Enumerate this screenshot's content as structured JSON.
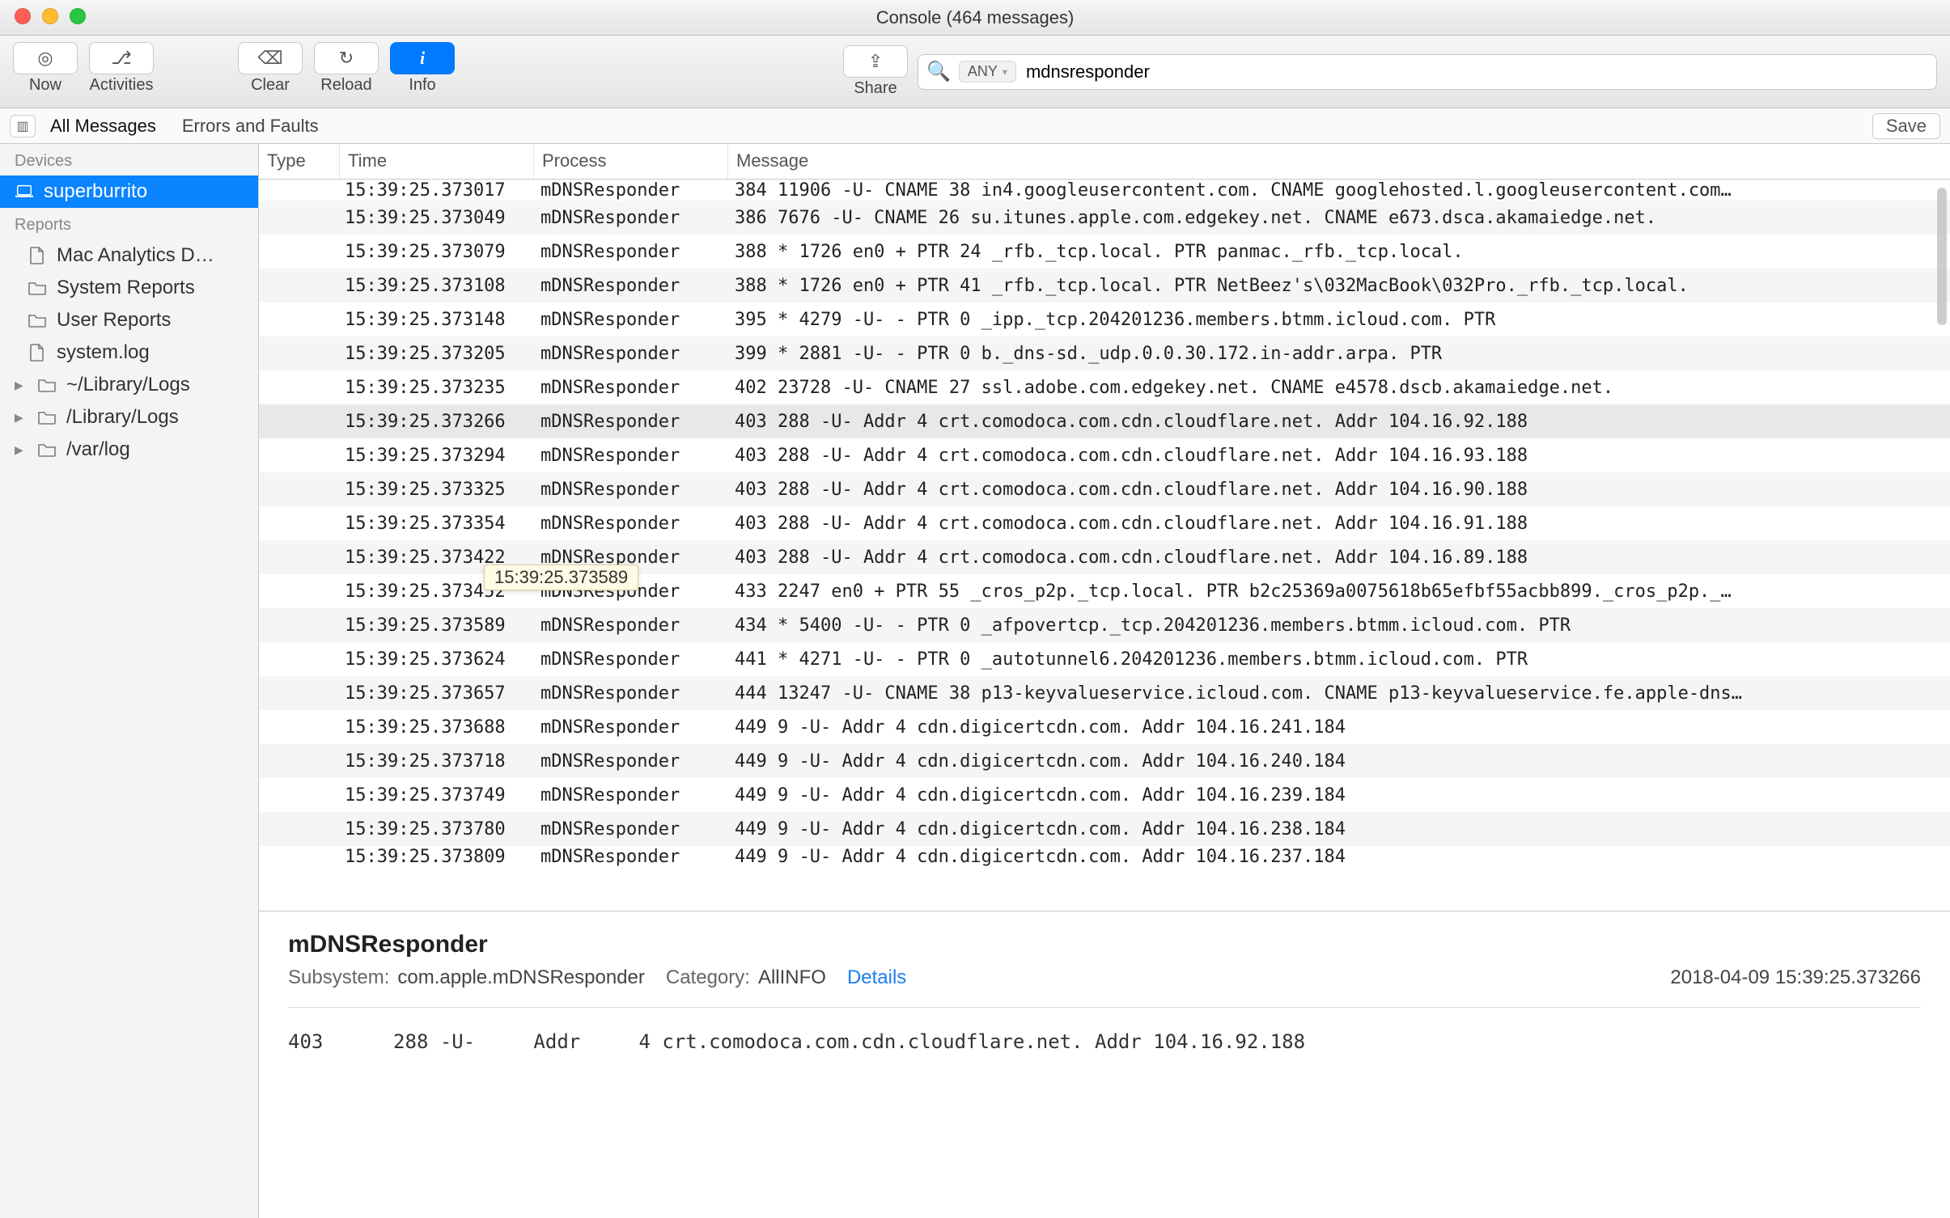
{
  "window": {
    "title": "Console (464 messages)"
  },
  "toolbar": {
    "now": "Now",
    "activities": "Activities",
    "clear": "Clear",
    "reload": "Reload",
    "info": "Info",
    "share": "Share"
  },
  "search": {
    "any_label": "ANY",
    "value": "mdnsresponder"
  },
  "filter": {
    "all": "All Messages",
    "errors": "Errors and Faults",
    "save": "Save"
  },
  "sidebar": {
    "devices_header": "Devices",
    "device": "superburrito",
    "reports_header": "Reports",
    "items": [
      {
        "icon": "doc",
        "label": "Mac Analytics D…"
      },
      {
        "icon": "folder",
        "label": "System Reports"
      },
      {
        "icon": "folder",
        "label": "User Reports"
      },
      {
        "icon": "doc",
        "label": "system.log"
      }
    ],
    "folders": [
      {
        "label": "~/Library/Logs"
      },
      {
        "label": "/Library/Logs"
      },
      {
        "label": "/var/log"
      }
    ]
  },
  "columns": {
    "type": "Type",
    "time": "Time",
    "process": "Process",
    "message": "Message"
  },
  "rows": [
    {
      "t": "15:39:25.373017",
      "p": "mDNSResponder",
      "m": "384    11906 -U-     CNAME   38 in4.googleusercontent.com. CNAME googlehosted.l.googleusercontent.com…",
      "partial_top": true
    },
    {
      "t": "15:39:25.373049",
      "p": "mDNSResponder",
      "m": "386     7676 -U-     CNAME   26 su.itunes.apple.com.edgekey.net. CNAME e673.dsca.akamaiedge.net."
    },
    {
      "t": "15:39:25.373079",
      "p": "mDNSResponder",
      "m": "388 *   1726 en0   + PTR     24 _rfb._tcp.local. PTR panmac._rfb._tcp.local."
    },
    {
      "t": "15:39:25.373108",
      "p": "mDNSResponder",
      "m": "388 *   1726 en0   + PTR     41 _rfb._tcp.local. PTR NetBeez's\\032MacBook\\032Pro._rfb._tcp.local."
    },
    {
      "t": "15:39:25.373148",
      "p": "mDNSResponder",
      "m": "395 *   4279 -U-   - PTR      0 _ipp._tcp.204201236.members.btmm.icloud.com. PTR"
    },
    {
      "t": "15:39:25.373205",
      "p": "mDNSResponder",
      "m": "399 *   2881 -U-   - PTR      0 b._dns-sd._udp.0.0.30.172.in-addr.arpa. PTR"
    },
    {
      "t": "15:39:25.373235",
      "p": "mDNSResponder",
      "m": "402    23728 -U-     CNAME   27 ssl.adobe.com.edgekey.net. CNAME e4578.dscb.akamaiedge.net."
    },
    {
      "t": "15:39:25.373266",
      "p": "mDNSResponder",
      "m": "403      288 -U-     Addr     4 crt.comodoca.com.cdn.cloudflare.net. Addr 104.16.92.188",
      "selected": true
    },
    {
      "t": "15:39:25.373294",
      "p": "mDNSResponder",
      "m": "403      288 -U-     Addr     4 crt.comodoca.com.cdn.cloudflare.net. Addr 104.16.93.188"
    },
    {
      "t": "15:39:25.373325",
      "p": "mDNSResponder",
      "m": "403      288 -U-     Addr     4 crt.comodoca.com.cdn.cloudflare.net. Addr 104.16.90.188"
    },
    {
      "t": "15:39:25.373354",
      "p": "mDNSResponder",
      "m": "403      288 -U-     Addr     4 crt.comodoca.com.cdn.cloudflare.net. Addr 104.16.91.188"
    },
    {
      "t": "15:39:25.373422",
      "p": "mDNSResponder",
      "m": "403      288 -U-     Addr     4 crt.comodoca.com.cdn.cloudflare.net. Addr 104.16.89.188"
    },
    {
      "t": "15:39:25.373452",
      "p": "mDNSResponder",
      "m": "433     2247 en0   + PTR     55 _cros_p2p._tcp.local. PTR b2c25369a0075618b65efbf55acbb899._cros_p2p._…",
      "tooltip_over": true
    },
    {
      "t": "15:39:25.373589",
      "p": "mDNSResponder",
      "m": "434 *   5400 -U-   - PTR      0 _afpovertcp._tcp.204201236.members.btmm.icloud.com. PTR"
    },
    {
      "t": "15:39:25.373624",
      "p": "mDNSResponder",
      "m": "441 *   4271 -U-   - PTR      0 _autotunnel6.204201236.members.btmm.icloud.com. PTR"
    },
    {
      "t": "15:39:25.373657",
      "p": "mDNSResponder",
      "m": "444    13247 -U-     CNAME   38 p13-keyvalueservice.icloud.com. CNAME p13-keyvalueservice.fe.apple-dns…"
    },
    {
      "t": "15:39:25.373688",
      "p": "mDNSResponder",
      "m": "449        9 -U-     Addr     4 cdn.digicertcdn.com. Addr 104.16.241.184"
    },
    {
      "t": "15:39:25.373718",
      "p": "mDNSResponder",
      "m": "449        9 -U-     Addr     4 cdn.digicertcdn.com. Addr 104.16.240.184"
    },
    {
      "t": "15:39:25.373749",
      "p": "mDNSResponder",
      "m": "449        9 -U-     Addr     4 cdn.digicertcdn.com. Addr 104.16.239.184"
    },
    {
      "t": "15:39:25.373780",
      "p": "mDNSResponder",
      "m": "449        9 -U-     Addr     4 cdn.digicertcdn.com. Addr 104.16.238.184"
    },
    {
      "t": "15:39:25.373809",
      "p": "mDNSResponder",
      "m": "449        9 -U-     Addr     4 cdn.digicertcdn.com. Addr 104.16.237.184",
      "partial_bottom": true
    }
  ],
  "tooltip": "15:39:25.373589",
  "detail": {
    "title": "mDNSResponder",
    "subsystem_label": "Subsystem:",
    "subsystem": "com.apple.mDNSResponder",
    "category_label": "Category:",
    "category": "AllINFO",
    "details_link": "Details",
    "timestamp": "2018-04-09 15:39:25.373266",
    "body": "403      288 -U-     Addr     4 crt.comodoca.com.cdn.cloudflare.net. Addr 104.16.92.188"
  }
}
